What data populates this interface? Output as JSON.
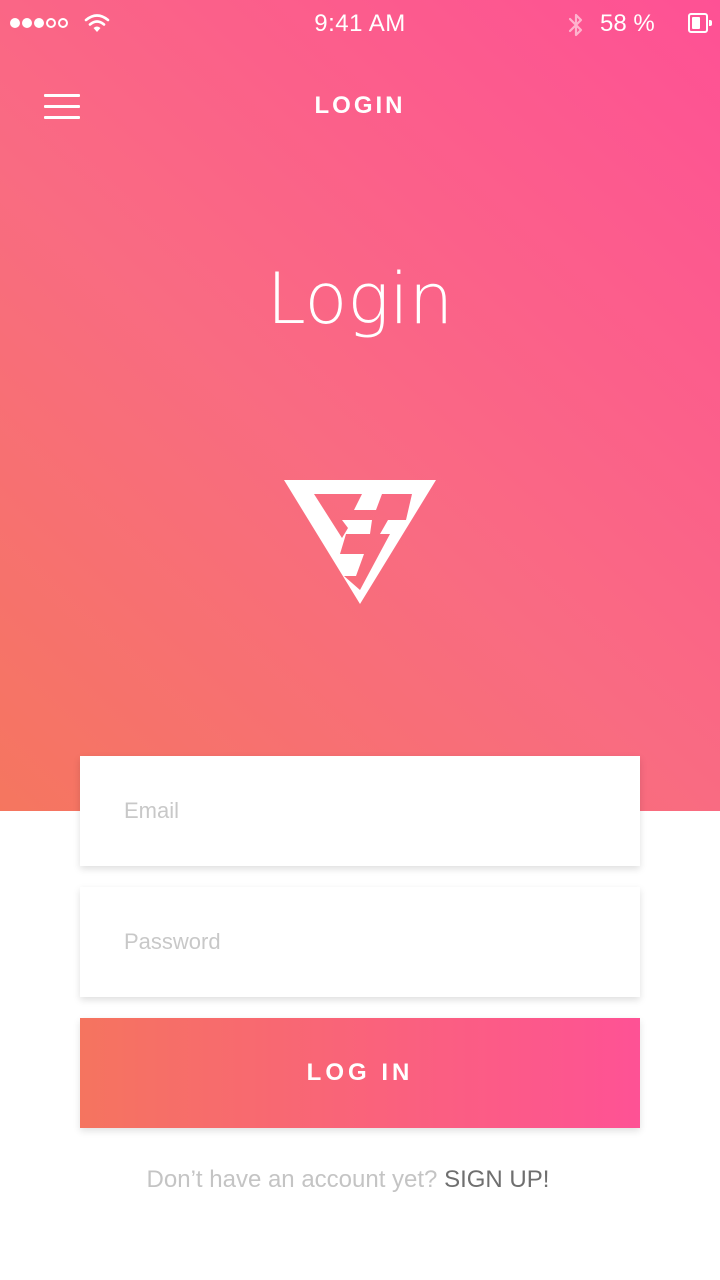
{
  "status_bar": {
    "time": "9:41 AM",
    "battery_percent": "58 %",
    "battery_level": 0.58,
    "signal_bars_filled": 3,
    "signal_bars_total": 5,
    "icons": [
      "signal-dots",
      "wifi-icon",
      "bluetooth-icon",
      "battery-icon"
    ]
  },
  "nav": {
    "title": "LOGIN",
    "menu_icon": "hamburger-menu-icon"
  },
  "hero": {
    "title": "Login",
    "logo": "vs-logo",
    "gradient_colors": [
      "#fe5195",
      "#f5765f"
    ]
  },
  "form": {
    "email_placeholder": "Email",
    "email_value": "",
    "password_placeholder": "Password",
    "password_value": "",
    "submit_label": "LOG IN"
  },
  "signup": {
    "prompt": "Don’t have an account yet?",
    "link": "SIGN UP!"
  },
  "colors": {
    "accent_start": "#f5745f",
    "accent_end": "#fe5295",
    "placeholder": "#c8c8c8",
    "link": "#6f6f6f"
  }
}
